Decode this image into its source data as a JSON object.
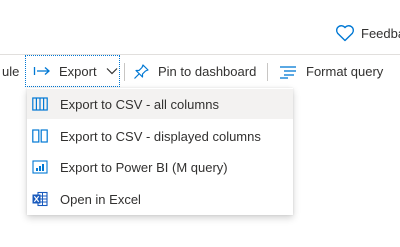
{
  "header": {
    "feedback_label": "Feedba",
    "feedback_icon": "heart-icon"
  },
  "toolbar": {
    "rule_label": "ule",
    "export_label": "Export",
    "export_icon": "arrow-right-bracket-icon",
    "pin_label": "Pin to dashboard",
    "pin_icon": "pin-icon",
    "format_label": "Format query",
    "format_icon": "format-lines-icon"
  },
  "export_menu": {
    "items": [
      {
        "label": "Export to CSV - all columns",
        "icon": "all-columns-icon",
        "highlighted": true
      },
      {
        "label": "Export to CSV - displayed columns",
        "icon": "displayed-columns-icon",
        "highlighted": false
      },
      {
        "label": "Export to Power BI (M query)",
        "icon": "power-bi-icon",
        "highlighted": false
      },
      {
        "label": "Open in Excel",
        "icon": "excel-icon",
        "highlighted": false
      }
    ]
  },
  "colors": {
    "accent": "#0078d4",
    "text": "#323130",
    "hover_bg": "#f3f2f1",
    "excel_green": "#185abd"
  }
}
